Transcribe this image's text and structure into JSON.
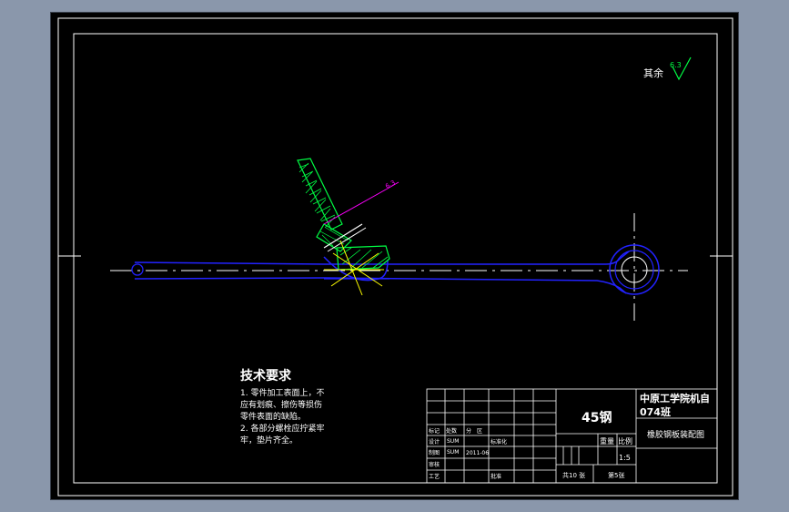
{
  "surface": {
    "label": "其余",
    "value": "6.3"
  },
  "annotation": {
    "value": "6.3"
  },
  "tech_req": {
    "title": "技术要求",
    "lines": [
      "1. 零件加工表面上，不",
      "应有划痕、擦伤等损伤",
      "零件表面的缺陷。",
      "2. 各部分螺栓应拧紧牢",
      "牢，垫片齐全。"
    ]
  },
  "title_block": {
    "material": "45钢",
    "school_line1": "中原工学院机自",
    "school_line2": "074班",
    "drawing_name": "橡胶钢板装配图",
    "weight_label": "重量",
    "scale_label": "比例",
    "scale_value": "1:5",
    "total_sheets": "共10 张",
    "sheet_no": "第5张",
    "row_labels": {
      "mark": "标记",
      "count": "处数",
      "zone": "分　区",
      "design": "设计",
      "design_name": "SUM",
      "standard": "标准化",
      "drafting": "制图",
      "drafting_name": "SUM",
      "date": "2011-06",
      "review": "审核",
      "process": "工艺",
      "approve": "批准"
    }
  },
  "colors": {
    "background": "#000000",
    "border": "#ffffff",
    "part": "#2222ff",
    "hatch": "#00ff44",
    "dim": "#ff00ff",
    "center_mark": "#ffff00"
  }
}
